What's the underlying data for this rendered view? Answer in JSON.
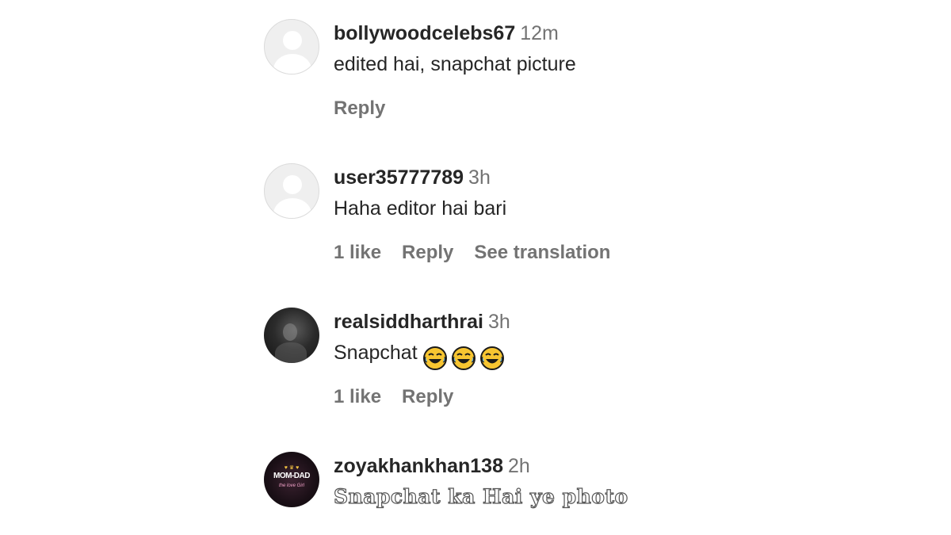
{
  "comments": [
    {
      "username": "bollywoodcelebs67",
      "time": "12m",
      "text": "edited hai, snapchat picture",
      "avatar": "default-avatar-icon",
      "likes": "",
      "reply_label": "Reply",
      "translation_label": ""
    },
    {
      "username": "user35777789",
      "time": "3h",
      "text": "Haha editor hai bari",
      "avatar": "default-avatar-icon",
      "likes": "1 like",
      "reply_label": "Reply",
      "translation_label": "See translation"
    },
    {
      "username": "realsiddharthrai",
      "time": "3h",
      "text": "Snapchat",
      "emojis": [
        "tears-of-joy-emoji",
        "tears-of-joy-emoji",
        "tears-of-joy-emoji"
      ],
      "avatar": "profile-photo",
      "likes": "1 like",
      "reply_label": "Reply",
      "translation_label": ""
    },
    {
      "username": "zoyakhankhan138",
      "time": "2h",
      "text": "Snapchat ka Hai ye photo",
      "avatar": "profile-photo-badge",
      "avatar_badge": {
        "line1": "♥ ♛ ♥",
        "line2": "MOM-DAD",
        "line3": "the love Girl"
      }
    }
  ],
  "colors": {
    "username": "#262626",
    "meta": "#737373",
    "emoji_face": "#f7c531"
  }
}
